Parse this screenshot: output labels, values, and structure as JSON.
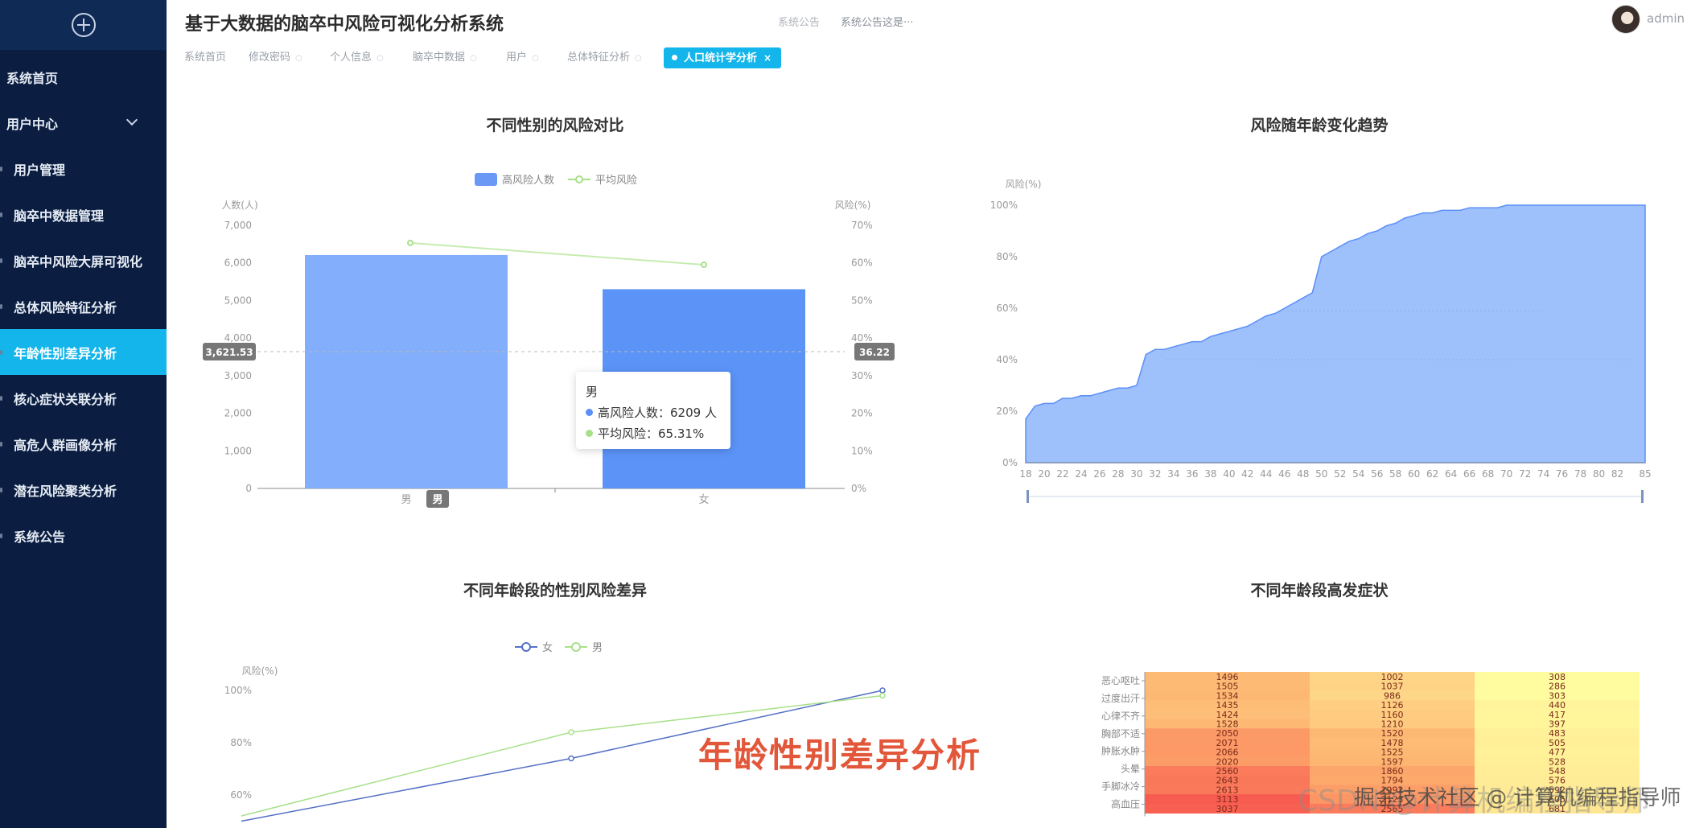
{
  "app": {
    "title": "基于大数据的脑卒中风险可视化分析系统",
    "notice_label": "系统公告",
    "notice_text": "系统公告这是···",
    "username": "admin"
  },
  "sidebar": {
    "items": [
      {
        "label": "系统首页",
        "level": 0
      },
      {
        "label": "用户中心",
        "level": 0,
        "expandable": true
      },
      {
        "label": "用户管理",
        "level": 1
      },
      {
        "label": "脑卒中数据管理",
        "level": 1
      },
      {
        "label": "脑卒中风险大屏可视化",
        "level": 1
      },
      {
        "label": "总体风险特征分析",
        "level": 1
      },
      {
        "label": "年龄性别差异分析",
        "level": 1,
        "active": true
      },
      {
        "label": "核心症状关联分析",
        "level": 1
      },
      {
        "label": "高危人群画像分析",
        "level": 1
      },
      {
        "label": "潜在风险聚类分析",
        "level": 1
      },
      {
        "label": "系统公告",
        "level": 1
      }
    ]
  },
  "tags": [
    {
      "label": "系统首页"
    },
    {
      "label": "修改密码"
    },
    {
      "label": "个人信息"
    },
    {
      "label": "脑卒中数据"
    },
    {
      "label": "用户"
    },
    {
      "label": "总体特征分析"
    },
    {
      "label": "人口统计学分析",
      "active": true,
      "close": "×"
    }
  ],
  "colors": {
    "accent": "#13b5ea",
    "sidebar_bg": "#0b1e41",
    "bar_blue": "#5b8ff9",
    "line_green": "#a8e08a"
  },
  "charts": {
    "gender": {
      "title": "不同性别的风险对比"
    },
    "trend": {
      "title": "风险随年龄变化趋势"
    },
    "agegender": {
      "title": "不同年龄段的性别风险差异"
    },
    "heatmap": {
      "title": "不同年龄段高发症状"
    }
  },
  "tooltip": {
    "header": "男",
    "rows": [
      {
        "label": "高风险人数：6209 人",
        "color": "#5b8ff9"
      },
      {
        "label": "平均风险：65.31%",
        "color": "#a8e08a"
      }
    ]
  },
  "overlay": {
    "big_text": "年龄性别差异分析",
    "watermark_main": "掘金技术社区 @ 计算机编程指导师",
    "watermark_ghost": "CSDN @计算机编程指导师"
  },
  "chart_data": [
    {
      "type": "bar",
      "title": "不同性别的风险对比",
      "categories": [
        "男",
        "女"
      ],
      "series": [
        {
          "name": "高风险人数",
          "type": "bar",
          "axis": "left",
          "values": [
            6209,
            5300
          ]
        },
        {
          "name": "平均风险",
          "type": "line",
          "axis": "right",
          "values": [
            65.31,
            59.5
          ]
        }
      ],
      "ylabel": "人数(人)",
      "y2label": "风险(%)",
      "ylim": [
        0,
        7000
      ],
      "y_ticks": [
        "0",
        "1,000",
        "2,000",
        "3,000",
        "4,000",
        "5,000",
        "6,000",
        "7,000"
      ],
      "y2lim": [
        0,
        70
      ],
      "y2_ticks": [
        "0%",
        "10%",
        "20%",
        "30%",
        "40%",
        "50%",
        "60%",
        "70%"
      ],
      "crosshair": {
        "left_value": "3,621.53",
        "right_value": "36.22",
        "category": "男"
      },
      "legend": "top"
    },
    {
      "type": "area",
      "title": "风险随年龄变化趋势",
      "ylabel": "风险(%)",
      "ylim": [
        0,
        100
      ],
      "y_ticks": [
        "0%",
        "20%",
        "40%",
        "60%",
        "80%",
        "100%"
      ],
      "x": [
        18,
        19,
        20,
        21,
        22,
        23,
        24,
        25,
        26,
        27,
        28,
        29,
        30,
        31,
        32,
        33,
        34,
        35,
        36,
        37,
        38,
        39,
        40,
        41,
        42,
        43,
        44,
        45,
        46,
        47,
        48,
        49,
        50,
        51,
        52,
        53,
        54,
        55,
        56,
        57,
        58,
        59,
        60,
        61,
        62,
        63,
        64,
        65,
        66,
        67,
        68,
        69,
        70,
        71,
        72,
        73,
        74,
        75,
        76,
        77,
        78,
        79,
        80,
        81,
        82,
        83,
        84,
        85
      ],
      "x_ticks": [
        18,
        20,
        22,
        24,
        26,
        28,
        30,
        32,
        34,
        36,
        38,
        40,
        42,
        44,
        46,
        48,
        50,
        52,
        54,
        56,
        58,
        60,
        62,
        64,
        66,
        68,
        70,
        72,
        74,
        76,
        78,
        80,
        82,
        85
      ],
      "series": [
        {
          "values": [
            17,
            22,
            23,
            23,
            25,
            25,
            26,
            26,
            27,
            28,
            29,
            29,
            30,
            42,
            44,
            44,
            45,
            46,
            47,
            47,
            49,
            50,
            51,
            52,
            53,
            55,
            57,
            58,
            60,
            62,
            64,
            66,
            80,
            82,
            84,
            86,
            87,
            89,
            90,
            92,
            93,
            95,
            96,
            97,
            97,
            98,
            98,
            98,
            99,
            99,
            99,
            99,
            100,
            100,
            100,
            100,
            100,
            100,
            100,
            100,
            100,
            100,
            100,
            100,
            100,
            100,
            100,
            100
          ]
        }
      ]
    },
    {
      "type": "line",
      "title": "不同年龄段的性别风险差异",
      "ylabel": "风险(%)",
      "y_ticks": [
        "60%",
        "80%",
        "100%"
      ],
      "series": [
        {
          "name": "女",
          "color": "#5470c6",
          "values": [
            50,
            74,
            100
          ]
        },
        {
          "name": "男",
          "color": "#a8e08a",
          "values": [
            52,
            84,
            98
          ]
        }
      ],
      "legend": "top"
    },
    {
      "type": "heatmap",
      "title": "不同年龄段高发症状",
      "row_labels": [
        "恶心呕吐",
        "过度出汗",
        "心律不齐",
        "胸部不适",
        "肿胀水肿",
        "头晕",
        "手脚冰冷",
        "高血压"
      ],
      "values": [
        [
          1496,
          1002,
          308
        ],
        [
          1505,
          1037,
          286
        ],
        [
          1534,
          986,
          303
        ],
        [
          1435,
          1126,
          440
        ],
        [
          1424,
          1160,
          417
        ],
        [
          1528,
          1210,
          397
        ],
        [
          2050,
          1520,
          483
        ],
        [
          2071,
          1478,
          505
        ],
        [
          2066,
          1525,
          477
        ],
        [
          2020,
          1597,
          528
        ],
        [
          2560,
          1860,
          548
        ],
        [
          2643,
          1794,
          576
        ],
        [
          2613,
          1992,
          592
        ],
        [
          3113,
          2123,
          605
        ],
        [
          3037,
          2565,
          681
        ]
      ]
    }
  ]
}
